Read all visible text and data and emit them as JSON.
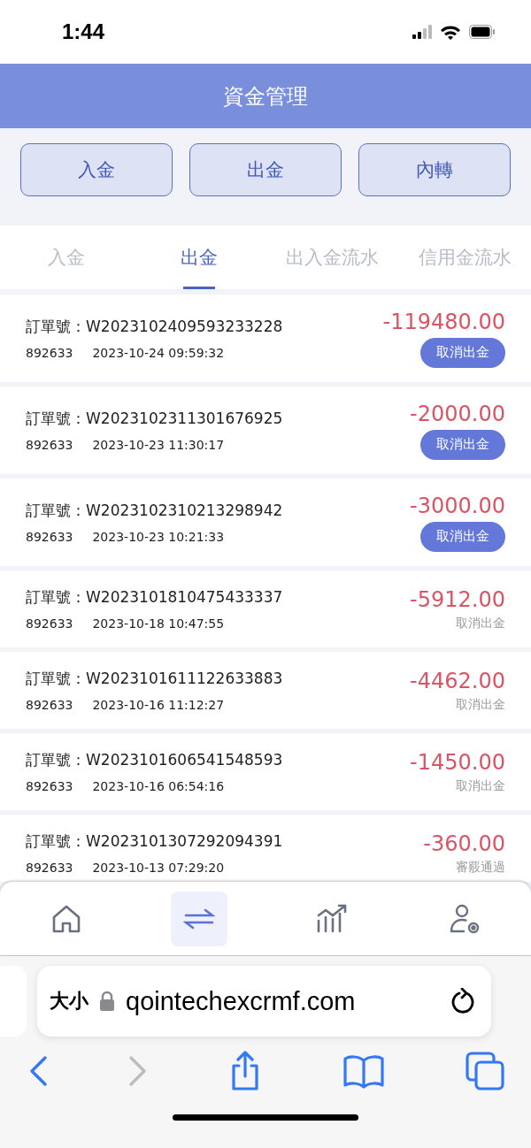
{
  "status_bar": {
    "time": "1:44"
  },
  "header": {
    "title": "資金管理"
  },
  "actions": [
    "入金",
    "出金",
    "內轉"
  ],
  "tabs": [
    {
      "label": "入金",
      "selected": false
    },
    {
      "label": "出金",
      "selected": true
    },
    {
      "label": "出入金流水",
      "selected": false
    },
    {
      "label": "信用金流水",
      "selected": false
    }
  ],
  "records": [
    {
      "order": "訂單號：W2023102409593233228",
      "account": "892633",
      "time": "2023-10-24 09:59:32",
      "amount": "-119480.00",
      "action": {
        "kind": "button",
        "label": "取消出金"
      }
    },
    {
      "order": "訂單號：W2023102311301676925",
      "account": "892633",
      "time": "2023-10-23 11:30:17",
      "amount": "-2000.00",
      "action": {
        "kind": "button",
        "label": "取消出金"
      }
    },
    {
      "order": "訂單號：W2023102310213298942",
      "account": "892633",
      "time": "2023-10-23 10:21:33",
      "amount": "-3000.00",
      "action": {
        "kind": "button",
        "label": "取消出金"
      }
    },
    {
      "order": "訂單號：W2023101810475433337",
      "account": "892633",
      "time": "2023-10-18 10:47:55",
      "amount": "-5912.00",
      "action": {
        "kind": "status",
        "label": "取消出金"
      }
    },
    {
      "order": "訂單號：W2023101611122633883",
      "account": "892633",
      "time": "2023-10-16 11:12:27",
      "amount": "-4462.00",
      "action": {
        "kind": "status",
        "label": "取消出金"
      }
    },
    {
      "order": "訂單號：W2023101606541548593",
      "account": "892633",
      "time": "2023-10-16 06:54:16",
      "amount": "-1450.00",
      "action": {
        "kind": "status",
        "label": "取消出金"
      }
    },
    {
      "order": "訂單號：W2023101307292094391",
      "account": "892633",
      "time": "2023-10-13 07:29:20",
      "amount": "-360.00",
      "action": {
        "kind": "status",
        "label": "審覈通過"
      }
    }
  ],
  "bottom_nav": [
    {
      "kind": "home",
      "selected": false
    },
    {
      "kind": "transfer",
      "selected": true
    },
    {
      "kind": "chart",
      "selected": false
    },
    {
      "kind": "user",
      "selected": false
    }
  ],
  "browser": {
    "text_size": "大小",
    "url": "qointechexcrmf.com"
  }
}
